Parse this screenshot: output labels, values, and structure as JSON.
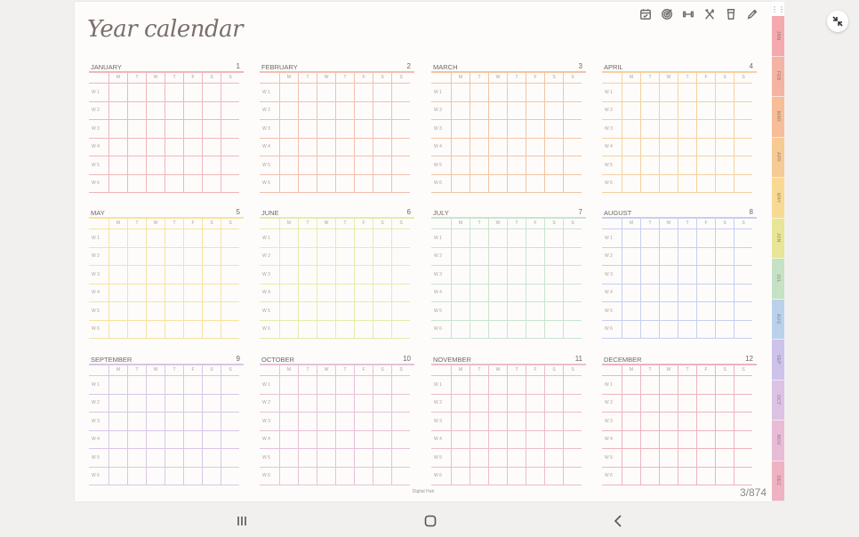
{
  "title": "Year calendar",
  "toolbar": [
    {
      "name": "calendar-icon"
    },
    {
      "name": "target-icon"
    },
    {
      "name": "dumbbell-icon"
    },
    {
      "name": "utensils-icon"
    },
    {
      "name": "glass-icon"
    },
    {
      "name": "pencil-icon"
    }
  ],
  "days": [
    "M",
    "T",
    "W",
    "T",
    "F",
    "S",
    "S"
  ],
  "weeks": [
    "W 1",
    "W 2",
    "W 3",
    "W 4",
    "W 5",
    "W 6"
  ],
  "months": [
    {
      "name": "JANUARY",
      "num": "1",
      "color": "#f0b6bb"
    },
    {
      "name": "FEBRUARY",
      "num": "2",
      "color": "#f3bfae"
    },
    {
      "name": "MARCH",
      "num": "3",
      "color": "#f3c4a3"
    },
    {
      "name": "APRIL",
      "num": "4",
      "color": "#f5d19f"
    },
    {
      "name": "MAY",
      "num": "5",
      "color": "#f6e3a0"
    },
    {
      "name": "JUNE",
      "num": "6",
      "color": "#e7eba9"
    },
    {
      "name": "JULY",
      "num": "7",
      "color": "#c9e4cf"
    },
    {
      "name": "AUGUST",
      "num": "8",
      "color": "#c6cfee"
    },
    {
      "name": "SEPTEMBER",
      "num": "9",
      "color": "#d8c6e6"
    },
    {
      "name": "OCTOBER",
      "num": "10",
      "color": "#e6c2d8"
    },
    {
      "name": "NOVEMBER",
      "num": "11",
      "color": "#ecbccb"
    },
    {
      "name": "DECEMBER",
      "num": "12",
      "color": "#efb3bd"
    }
  ],
  "tabs": [
    {
      "label": "JAN",
      "color": "#f3a9ae"
    },
    {
      "label": "FEB",
      "color": "#f5b3a3"
    },
    {
      "label": "MAR",
      "color": "#f6bd98"
    },
    {
      "label": "APR",
      "color": "#f7ca93"
    },
    {
      "label": "MAY",
      "color": "#f8d992"
    },
    {
      "label": "JUN",
      "color": "#e8e596"
    },
    {
      "label": "JUL",
      "color": "#c5e2c4"
    },
    {
      "label": "AUG",
      "color": "#b9d2ea"
    },
    {
      "label": "SEP",
      "color": "#cdc3ea"
    },
    {
      "label": "OCT",
      "color": "#dcc2e4"
    },
    {
      "label": "NOV",
      "color": "#e8bcd6"
    },
    {
      "label": "DEC",
      "color": "#eeb2c3"
    }
  ],
  "footer": "Digital Hub",
  "page_indicator": "3/874",
  "grip": "⋮⋮",
  "nav": {
    "recent": "recent-apps-icon",
    "home": "home-icon",
    "back": "back-icon"
  }
}
